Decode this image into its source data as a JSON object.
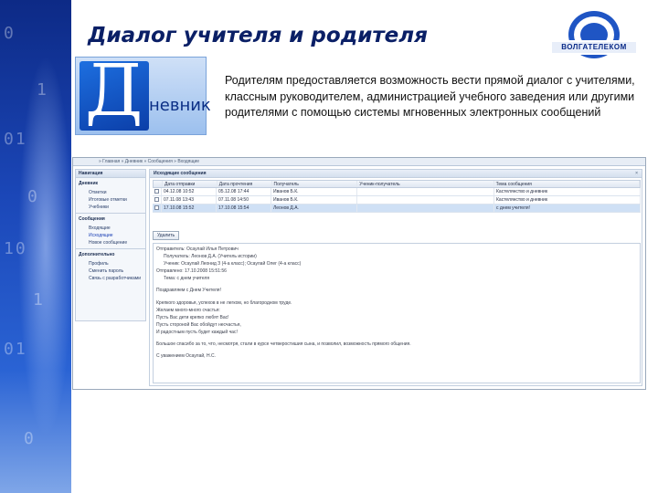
{
  "slide": {
    "title": "Диалог учителя и родителя",
    "description": "Родителям предоставляется возможность вести прямой диалог с учителями, классным руководителем, администрацией учебного заведения или другими родителями с помощью системы мгновенных электронных сообщений",
    "brand_text": "ВОЛГАТЕЛЕКОМ",
    "logo_letter": "Д",
    "logo_word": "невник",
    "left_digits": [
      "0",
      "1",
      "01",
      "0",
      "10",
      "1",
      "01",
      "0"
    ]
  },
  "app": {
    "breadcrumb": "» Главная » Дневник » Сообщения » Входящие",
    "sidebar": {
      "header": "Навигация",
      "sections": [
        {
          "title": "Дневник",
          "items": [
            "Отметки",
            "Итоговые отметки",
            "Учебники"
          ]
        },
        {
          "title": "Сообщения",
          "items": [
            "Входящие",
            "Исходящие",
            "Новое сообщение"
          ]
        },
        {
          "title": "Дополнительно",
          "items": [
            "Профиль",
            "Сменить пароль",
            "Связь с разработчиками"
          ]
        }
      ]
    },
    "main_header": "Исходящие сообщения",
    "close_label": "×",
    "grid": {
      "columns": [
        "",
        "Дата отправки",
        "Дата прочтения",
        "Получатель",
        "Ученик-получатель",
        "Тема сообщения"
      ],
      "rows": [
        {
          "sent": "04.12.08 10:52",
          "read": "05.12.08 17:44",
          "to": "Иванов Б.К.",
          "student": "",
          "subject": "Кастелянство и дневник"
        },
        {
          "sent": "07.11.08 13:43",
          "read": "07.11.08 14:50",
          "to": "Иванов Б.К.",
          "student": "",
          "subject": "Кастелянство и дневник"
        },
        {
          "sent": "17.10.08 15:52",
          "read": "17.10.08 15:54",
          "to": "Леонов Д.А.",
          "student": "",
          "subject": "с днем учителя!"
        }
      ]
    },
    "delete_label": "Удалить",
    "message": {
      "from": "Отправитель: Осаулай Илья Петрович",
      "to": "Получатель: Леонов Д.А. (Учитель истории)",
      "student": "Ученик: Осаулай Леонид З (4-а класс); Осаулай Олег (4-а класс)",
      "sent": "Отправлено: 17.10.2008 15:51:56",
      "subject": "Тема: с днем учителя",
      "body": [
        "Поздравляем с Днем Учителя!",
        "",
        "Крепкого здоровья, успехов в не легком, но благородном труде.",
        "Желаем много-много счастья:",
        "Пусть Вас дети крепко любят Вас!",
        "Пусть стороной Вас обойдут несчастья,",
        "И радостным пусть будет каждый час!",
        "",
        "Большое спасибо за то, что, несмотря, стали в курсе четверостишия сына, и позволил, возможность прямого общения.",
        "",
        "С уважением Осаулай, Н.С."
      ]
    }
  }
}
